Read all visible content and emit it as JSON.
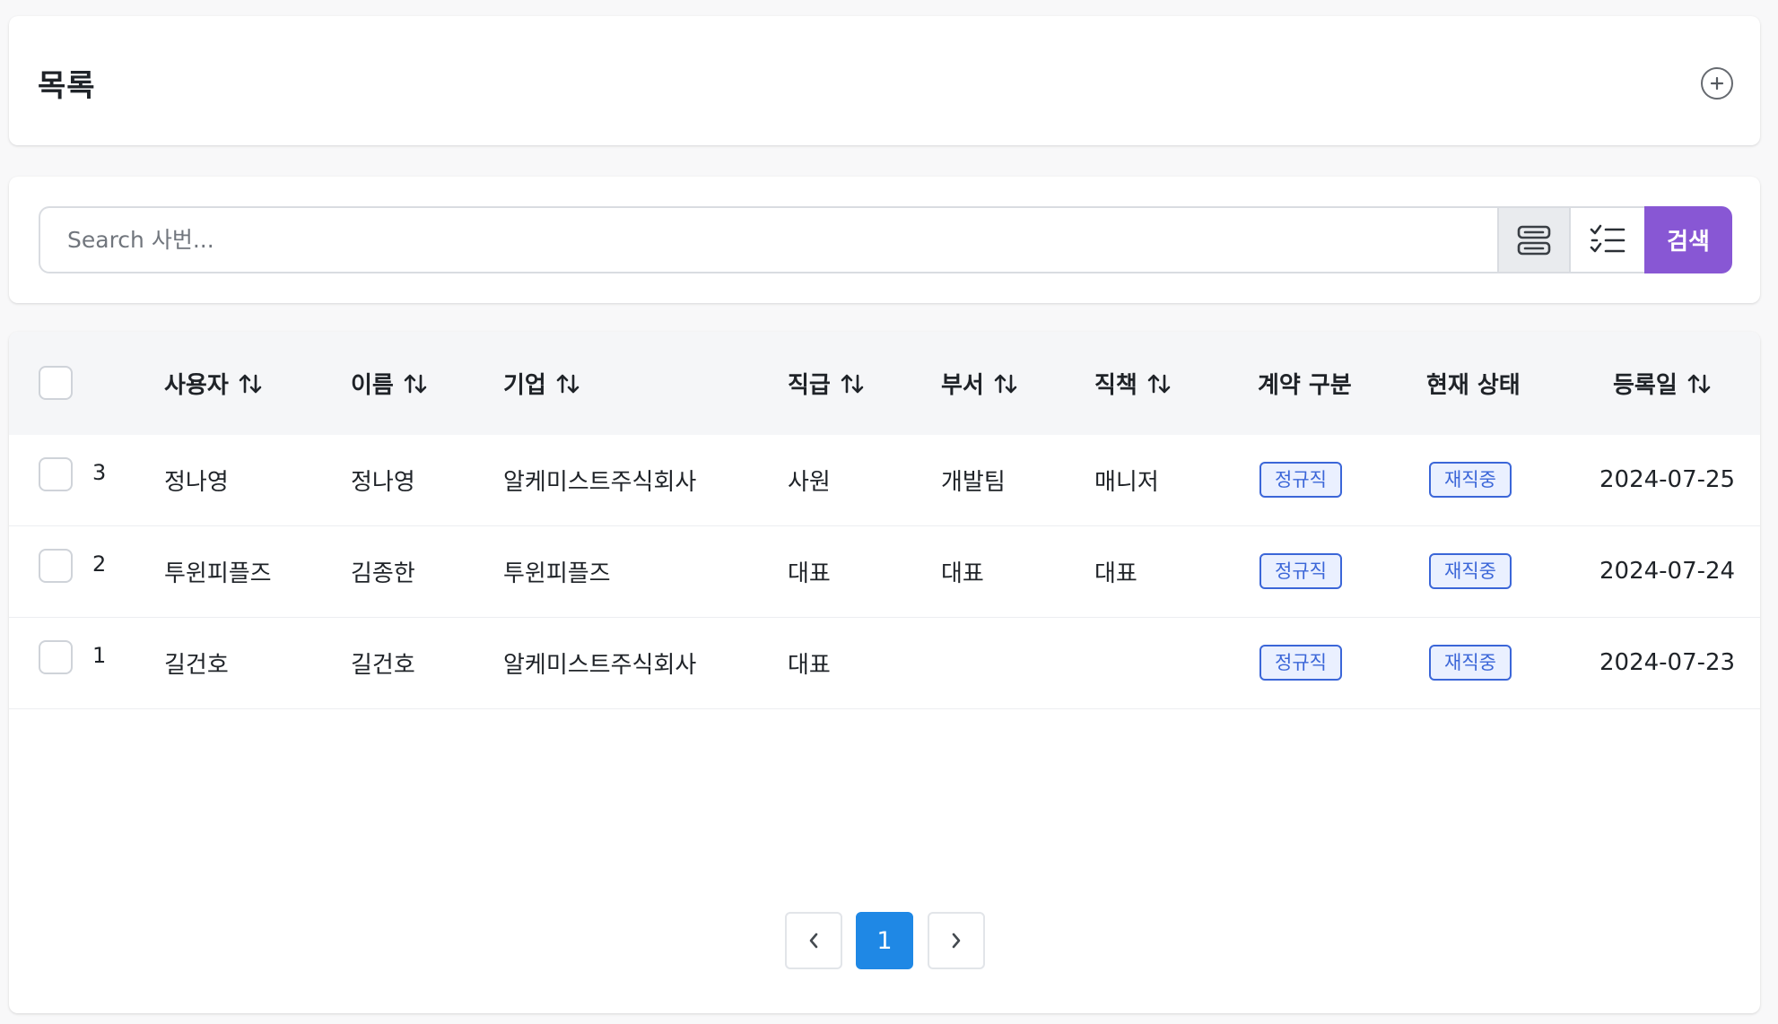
{
  "header": {
    "title": "목록",
    "add_icon": "plus-circle-icon"
  },
  "search": {
    "placeholder": "Search 사번...",
    "submit_label": "검색",
    "list_view_icon": "server-list-icon",
    "check_view_icon": "checklist-icon",
    "submit_color": "#8857d4"
  },
  "table": {
    "columns": [
      {
        "label": "사용자",
        "sortable": true
      },
      {
        "label": "이름",
        "sortable": true
      },
      {
        "label": "기업",
        "sortable": true
      },
      {
        "label": "직급",
        "sortable": true
      },
      {
        "label": "부서",
        "sortable": true
      },
      {
        "label": "직책",
        "sortable": true
      },
      {
        "label": "계약 구분",
        "sortable": false
      },
      {
        "label": "현재 상태",
        "sortable": false
      },
      {
        "label": "등록일",
        "sortable": true
      }
    ],
    "rows": [
      {
        "id": "3",
        "user": "정나영",
        "name": "정나영",
        "company": "알케미스트주식회사",
        "rank": "사원",
        "dept": "개발팀",
        "position": "매니저",
        "contract": "정규직",
        "status": "재직중",
        "registered": "2024-07-25"
      },
      {
        "id": "2",
        "user": "투윈피플즈",
        "name": "김종한",
        "company": "투윈피플즈",
        "rank": "대표",
        "dept": "대표",
        "position": "대표",
        "contract": "정규직",
        "status": "재직중",
        "registered": "2024-07-24"
      },
      {
        "id": "1",
        "user": "길건호",
        "name": "길건호",
        "company": "알케미스트주식회사",
        "rank": "대표",
        "dept": "",
        "position": "",
        "contract": "정규직",
        "status": "재직중",
        "registered": "2024-07-23"
      }
    ]
  },
  "pagination": {
    "current": "1",
    "prev_icon": "chevron-left-icon",
    "next_icon": "chevron-right-icon",
    "active_color": "#1f88e5"
  },
  "colors": {
    "badge_border": "#3b66d8",
    "badge_bg": "#eaf0ff"
  }
}
